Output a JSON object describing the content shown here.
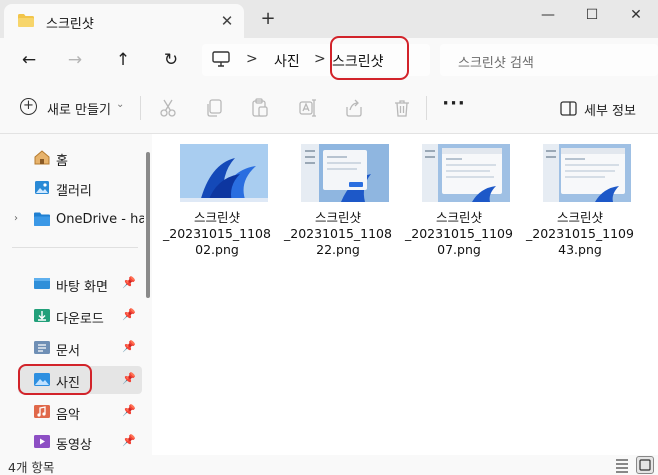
{
  "tab": {
    "title": "스크린샷",
    "close_glyph": "✕",
    "new_tab_glyph": "+"
  },
  "window": {
    "minimize_glyph": "—",
    "maximize_glyph": "☐",
    "close_glyph": "✕"
  },
  "nav": {
    "back_glyph": "←",
    "forward_glyph": "→",
    "up_glyph": "↑",
    "refresh_glyph": "↻",
    "breadcrumb": [
      "사진",
      "스크린샷"
    ],
    "separator": ">",
    "search_placeholder": "스크린샷 검색"
  },
  "commands": {
    "new_label": "새로 만들기",
    "new_chevron": "⌄",
    "more_glyph": "···",
    "details_label": "세부 정보"
  },
  "sidebar": {
    "items": [
      {
        "label": "홈",
        "icon": "home-icon"
      },
      {
        "label": "갤러리",
        "icon": "gallery-icon"
      },
      {
        "label": "OneDrive - hans",
        "icon": "onedrive-icon"
      },
      {
        "label": "바탕 화면",
        "icon": "desktop-icon",
        "pinned": true
      },
      {
        "label": "다운로드",
        "icon": "download-icon",
        "pinned": true
      },
      {
        "label": "문서",
        "icon": "documents-icon",
        "pinned": true
      },
      {
        "label": "사진",
        "icon": "pictures-icon",
        "pinned": true,
        "selected": true
      },
      {
        "label": "음악",
        "icon": "music-icon",
        "pinned": true
      },
      {
        "label": "동영상",
        "icon": "videos-icon",
        "pinned": true
      }
    ],
    "pin_glyph": "📌",
    "chevron_glyph": "›"
  },
  "files": [
    {
      "name": "스크린샷_20231015_110802.png",
      "line1": "스크린샷",
      "line2": "_20231015_1108",
      "line3": "02.png",
      "thumb": "wallpaper"
    },
    {
      "name": "스크린샷_20231015_110822.png",
      "line1": "스크린샷",
      "line2": "_20231015_1108",
      "line3": "22.png",
      "thumb": "dialog"
    },
    {
      "name": "스크린샷_20231015_110907.png",
      "line1": "스크린샷",
      "line2": "_20231015_1109",
      "line3": "07.png",
      "thumb": "window"
    },
    {
      "name": "스크린샷_20231015_110943.png",
      "line1": "스크린샷",
      "line2": "_20231015_1109",
      "line3": "43.png",
      "thumb": "window"
    }
  ],
  "status": {
    "count": "4개 항목"
  },
  "colors": {
    "highlight": "#d2232a",
    "folder": "#f2c54a",
    "accent": "#0067c0"
  }
}
